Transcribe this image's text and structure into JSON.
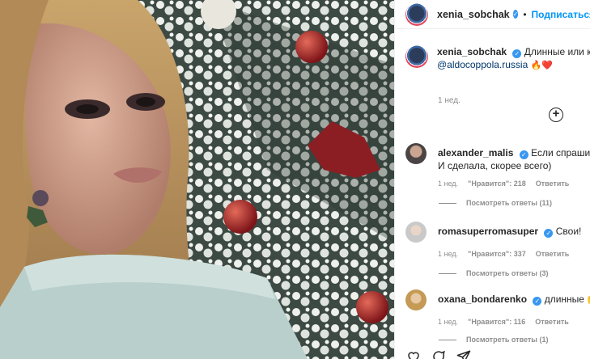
{
  "post": {
    "author": "xenia_sobchak",
    "follow_label": "Подписаться",
    "separator": "•",
    "caption_text": "Длинные или корот",
    "caption_mention": "@aldocoppola.russia",
    "caption_emojis": "🔥❤️",
    "time": "1 нед."
  },
  "comments": [
    {
      "user": "alexander_malis",
      "text": "Если спрашиваеш",
      "text2": "И сделала, скорее всего)",
      "time": "1 нед.",
      "likes": "\"Нравится\": 218",
      "reply": "Ответить",
      "replies": "Посмотреть ответы (11)"
    },
    {
      "user": "romasuperromasuper",
      "text": "Свои!",
      "time": "1 нед.",
      "likes": "\"Нравится\": 337",
      "reply": "Ответить",
      "replies": "Посмотреть ответы (3)"
    },
    {
      "user": "oxana_bondarenko",
      "text": "длинные 🙌",
      "time": "1 нед.",
      "likes": "\"Нравится\": 116",
      "reply": "Ответить",
      "replies": "Посмотреть ответы (1)"
    }
  ],
  "icons": [
    "heart-icon",
    "comment-icon",
    "share-icon",
    "add-comment-icon",
    "verified-badge-icon"
  ],
  "colors": {
    "link": "#0095f6",
    "mention": "#00376b",
    "meta": "#8e8e8e",
    "verified": "#3897f0"
  }
}
